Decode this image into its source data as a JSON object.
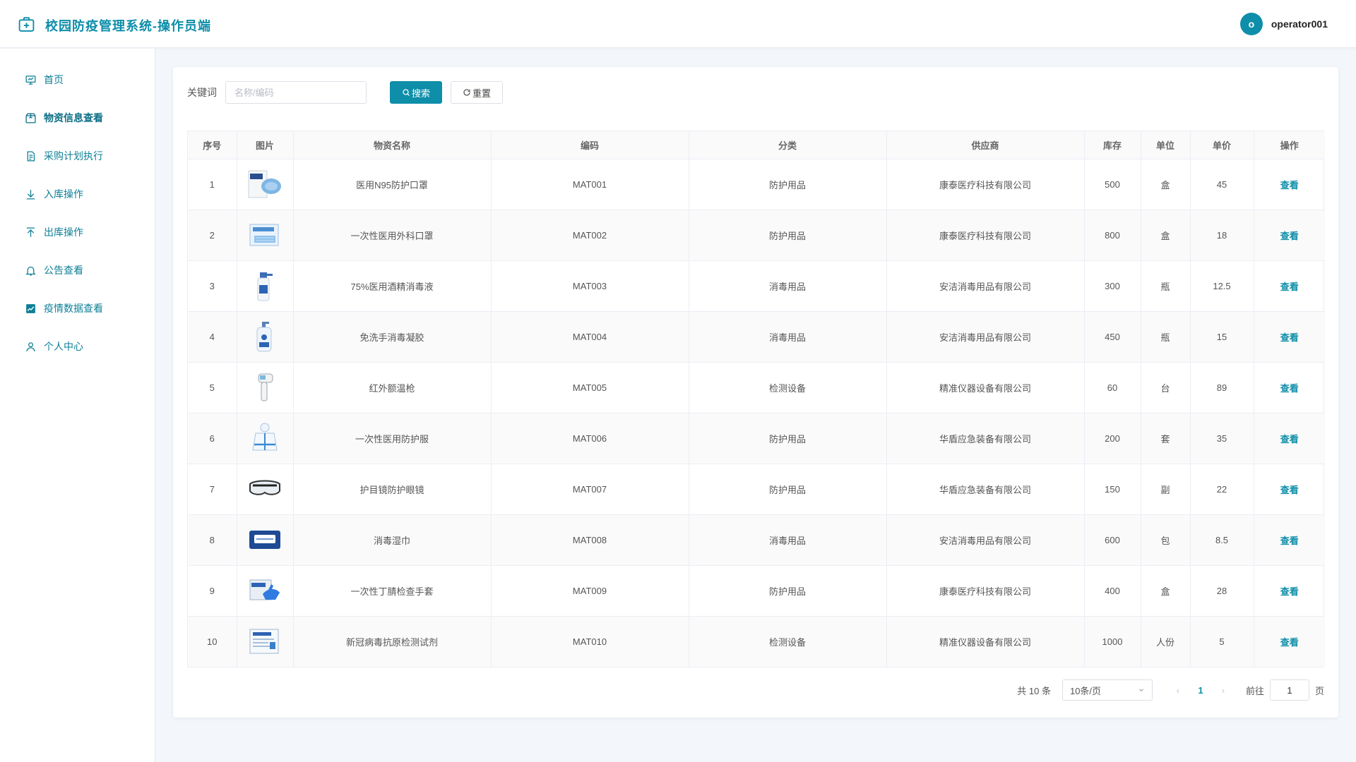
{
  "app": {
    "title": "校园防疫管理系统-操作员端",
    "user_initial": "o",
    "username": "operator001",
    "accent_color": "#0e8ea9"
  },
  "sidebar": {
    "items": [
      {
        "label": "首页",
        "icon": "presentation-icon",
        "active": false
      },
      {
        "label": "物资信息查看",
        "icon": "package-icon",
        "active": true
      },
      {
        "label": "采购计划执行",
        "icon": "document-icon",
        "active": false
      },
      {
        "label": "入库操作",
        "icon": "download-icon",
        "active": false
      },
      {
        "label": "出库操作",
        "icon": "upload-icon",
        "active": false
      },
      {
        "label": "公告查看",
        "icon": "bell-icon",
        "active": false
      },
      {
        "label": "疫情数据查看",
        "icon": "chart-icon",
        "active": false
      },
      {
        "label": "个人中心",
        "icon": "user-icon",
        "active": false
      }
    ]
  },
  "search": {
    "label": "关键词",
    "placeholder": "名称/编码",
    "value": "",
    "search_button": "搜索",
    "reset_button": "重置"
  },
  "table": {
    "columns": [
      "序号",
      "图片",
      "物资名称",
      "编码",
      "分类",
      "供应商",
      "库存",
      "单位",
      "单价",
      "操作"
    ],
    "rows": [
      {
        "no": "1",
        "image": "n95-mask-box",
        "name": "医用N95防护口罩",
        "code": "MAT001",
        "category": "防护用品",
        "supplier": "康泰医疗科技有限公司",
        "stock": "500",
        "unit": "盒",
        "price": "45",
        "action": "查看"
      },
      {
        "no": "2",
        "image": "surgical-mask-box",
        "name": "一次性医用外科口罩",
        "code": "MAT002",
        "category": "防护用品",
        "supplier": "康泰医疗科技有限公司",
        "stock": "800",
        "unit": "盒",
        "price": "18",
        "action": "查看"
      },
      {
        "no": "3",
        "image": "spray-bottle",
        "name": "75%医用酒精消毒液",
        "code": "MAT003",
        "category": "消毒用品",
        "supplier": "安洁消毒用品有限公司",
        "stock": "300",
        "unit": "瓶",
        "price": "12.5",
        "action": "查看"
      },
      {
        "no": "4",
        "image": "pump-bottle",
        "name": "免洗手消毒凝胶",
        "code": "MAT004",
        "category": "消毒用品",
        "supplier": "安洁消毒用品有限公司",
        "stock": "450",
        "unit": "瓶",
        "price": "15",
        "action": "查看"
      },
      {
        "no": "5",
        "image": "thermometer-gun",
        "name": "红外额温枪",
        "code": "MAT005",
        "category": "检测设备",
        "supplier": "精准仪器设备有限公司",
        "stock": "60",
        "unit": "台",
        "price": "89",
        "action": "查看"
      },
      {
        "no": "6",
        "image": "protective-suit",
        "name": "一次性医用防护服",
        "code": "MAT006",
        "category": "防护用品",
        "supplier": "华盾应急装备有限公司",
        "stock": "200",
        "unit": "套",
        "price": "35",
        "action": "查看"
      },
      {
        "no": "7",
        "image": "goggles",
        "name": "护目镜防护眼镜",
        "code": "MAT007",
        "category": "防护用品",
        "supplier": "华盾应急装备有限公司",
        "stock": "150",
        "unit": "副",
        "price": "22",
        "action": "查看"
      },
      {
        "no": "8",
        "image": "wipes-pack",
        "name": "消毒湿巾",
        "code": "MAT008",
        "category": "消毒用品",
        "supplier": "安洁消毒用品有限公司",
        "stock": "600",
        "unit": "包",
        "price": "8.5",
        "action": "查看"
      },
      {
        "no": "9",
        "image": "gloves-box",
        "name": "一次性丁腈检查手套",
        "code": "MAT009",
        "category": "防护用品",
        "supplier": "康泰医疗科技有限公司",
        "stock": "400",
        "unit": "盒",
        "price": "28",
        "action": "查看"
      },
      {
        "no": "10",
        "image": "test-kit-box",
        "name": "新冠病毒抗原检测试剂",
        "code": "MAT010",
        "category": "检测设备",
        "supplier": "精准仪器设备有限公司",
        "stock": "1000",
        "unit": "人份",
        "price": "5",
        "action": "查看"
      }
    ]
  },
  "pagination": {
    "total": "共 10 条",
    "page_size": "10条/页",
    "current_page": "1",
    "goto_label": "前往",
    "goto_value": "1",
    "goto_suffix": "页"
  }
}
